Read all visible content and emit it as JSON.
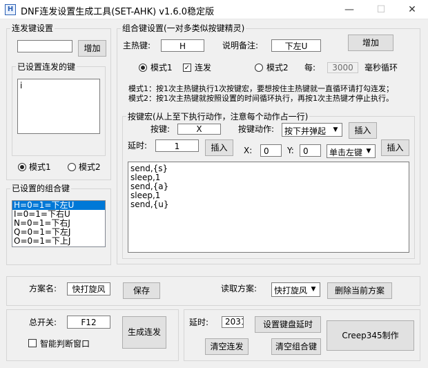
{
  "window": {
    "title": "DNF连发设置生成工具(SET-AHK) v1.6.0稳定版",
    "app_icon": "H",
    "minimize": "—",
    "maximize": "☐",
    "close": "✕"
  },
  "repeat": {
    "group_title": "连发键设置",
    "key_value": "",
    "add_label": "增加",
    "set_keys_title": "已设置连发的键",
    "set_keys": [
      "i"
    ],
    "mode1": "模式1",
    "mode2": "模式2"
  },
  "combo_list": {
    "group_title": "已设置的组合键",
    "items": [
      "H=0=1=下左U",
      "I=0=1=下右U",
      "N=0=1=下右J",
      "Q=0=1=下左J",
      "O=0=1=下上J"
    ]
  },
  "combo": {
    "group_title": "组合键设置(一对多类似按键精灵)",
    "hotkey_label": "主热键:",
    "hotkey_value": "H",
    "note_label": "说明备注:",
    "note_value": "下左U",
    "add_label": "增加",
    "mode1": "模式1",
    "repeat_label": "连发",
    "mode2": "模式2",
    "every_label": "每:",
    "every_value": "3000",
    "every_unit": "毫秒循环",
    "desc1": "模式1：按1次主热键执行1次按键宏，要想按住主热键就一直循环请打勾连发；",
    "desc2": "模式2：按1次主热键就按照设置的时间循环执行，再按1次主热键才停止执行。"
  },
  "macro": {
    "group_title": "按键宏(从上至下执行动作，注意每个动作占一行)",
    "key_label": "按键:",
    "key_value": "X",
    "action_label": "按键动作:",
    "action_value": "按下并弹起",
    "insert1": "插入",
    "delay_label": "延时:",
    "delay_value": "1",
    "insert2": "插入",
    "x_label": "X:",
    "x_value": "0",
    "y_label": "Y:",
    "y_value": "0",
    "mouse_value": "单击左键",
    "insert3": "插入",
    "script_lines": [
      "send,{s}",
      "sleep,1",
      "send,{a}",
      "sleep,1",
      "send,{u}"
    ]
  },
  "scheme": {
    "name_label": "方案名:",
    "name_value": "快打旋风",
    "save_label": "保存",
    "load_label": "读取方案:",
    "load_value": "快打旋风",
    "delete_label": "删除当前方案"
  },
  "bottom_left": {
    "switch_label": "总开关:",
    "switch_value": "F12",
    "smart_label": "智能判断窗口",
    "generate_label": "生成连发"
  },
  "bottom_right": {
    "delay_label": "延时:",
    "delay_value": "2031",
    "set_delay_label": "设置键盘延时",
    "clear_repeat_label": "清空连发",
    "clear_combo_label": "清空组合键",
    "credit_label": "Creep345制作"
  }
}
